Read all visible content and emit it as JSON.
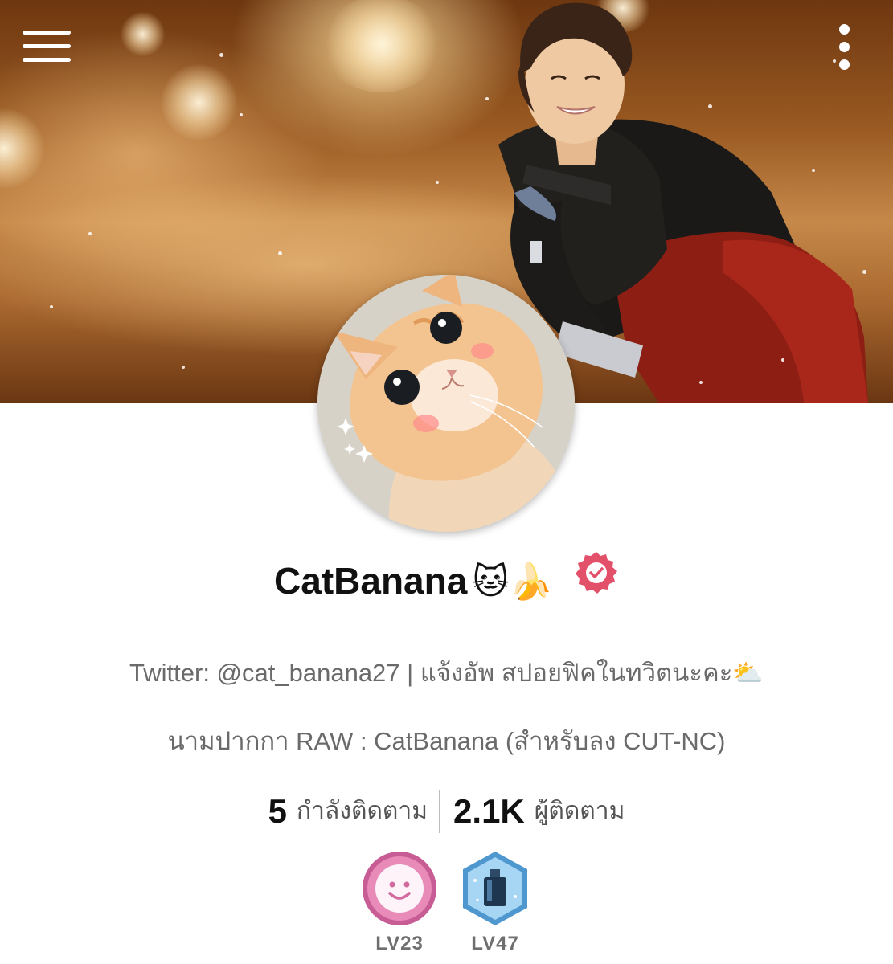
{
  "header": {
    "menu_icon": "hamburger-menu-icon",
    "more_icon": "vertical-ellipsis-icon"
  },
  "profile": {
    "display_name": "CatBanana",
    "name_emoji": "🐱🍌",
    "verified_icon": "verified-badge-icon",
    "verified_color": "#e3506a",
    "bio_line_1": "Twitter: @cat_banana27 | แจ้งอัพ สปอยฟิคในทวิตนะคะ⛅",
    "bio_line_2": "นามปากกา RAW : CatBanana (สำหรับลง CUT-NC)"
  },
  "stats": {
    "following_count": "5",
    "following_label": "กำลังติดตาม",
    "followers_count": "2.1K",
    "followers_label": "ผู้ติดตาม"
  },
  "badges": [
    {
      "icon": "smiley-coin-badge-icon",
      "level": "LV23",
      "color": "#e88bb8"
    },
    {
      "icon": "ink-bottle-hexagon-badge-icon",
      "level": "LV47",
      "color": "#6fb8e8"
    }
  ]
}
